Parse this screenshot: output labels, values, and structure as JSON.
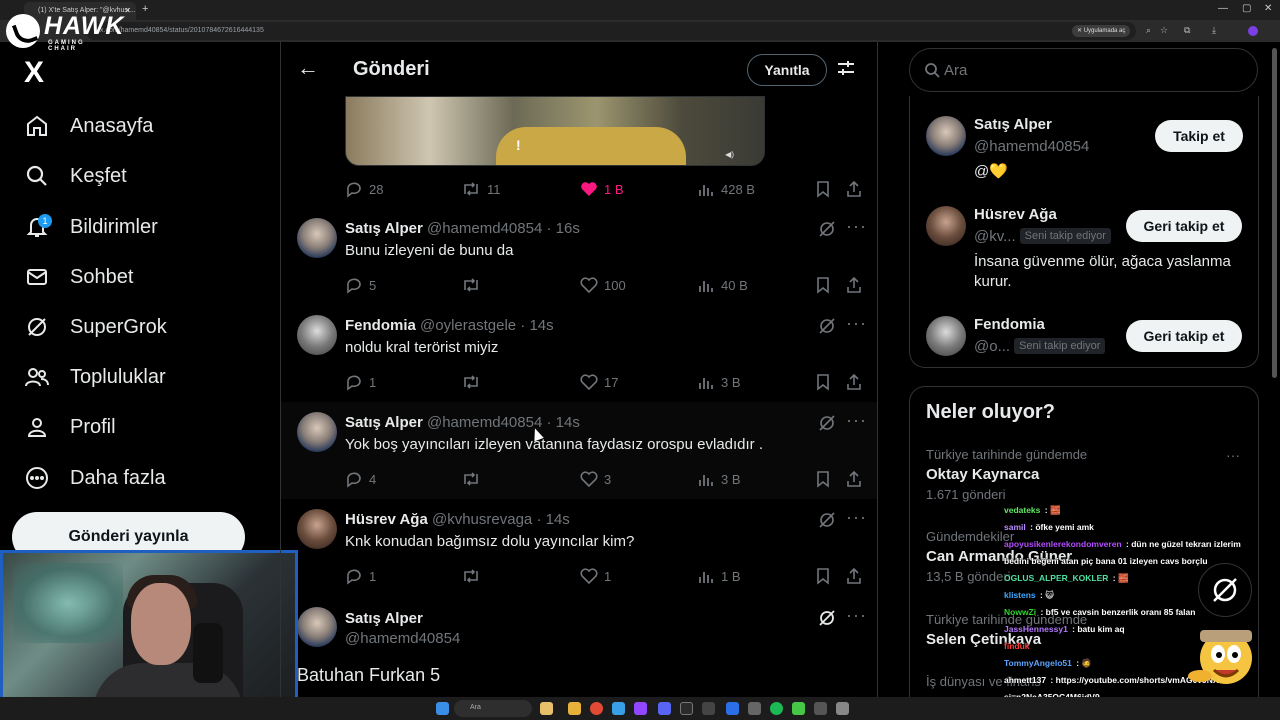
{
  "browser": {
    "tab_title": "(1) X'te Satış Alper: \"@kvhusr...",
    "url": "x.com/hamemd40854/status/2010784672616444135",
    "app_button": "Uygulamada aç"
  },
  "overlay": {
    "brand": "HAWK",
    "brand_sub": "GAMING CHAIR"
  },
  "nav": {
    "logo": "X",
    "items": [
      {
        "label": "Anasayfa",
        "icon": "home-icon"
      },
      {
        "label": "Keşfet",
        "icon": "search-icon"
      },
      {
        "label": "Bildirimler",
        "icon": "bell-icon",
        "badge": "1"
      },
      {
        "label": "Sohbet",
        "icon": "mail-icon"
      },
      {
        "label": "SuperGrok",
        "icon": "grok-icon"
      },
      {
        "label": "Topluluklar",
        "icon": "people-icon"
      },
      {
        "label": "Profil",
        "icon": "person-icon"
      },
      {
        "label": "Daha fazla",
        "icon": "more-circle-icon"
      }
    ],
    "post_button": "Gönderi yayınla"
  },
  "header": {
    "title": "Gönderi",
    "reply_button": "Yanıtla"
  },
  "main_post_stats": {
    "replies": "28",
    "reposts": "11",
    "likes": "1 B",
    "views": "428 B",
    "liked": true,
    "like_color": "#f91880"
  },
  "replies": [
    {
      "name": "Satış Alper",
      "handle": "@hamemd40854",
      "time": "· 16s",
      "text": "Bunu izleyeni de bunu da",
      "replies": "5",
      "reposts": "",
      "likes": "100",
      "views": "40 B"
    },
    {
      "name": "Fendomia",
      "handle": "@oylerastgele",
      "time": "· 14s",
      "text": "noldu kral terörist miyiz",
      "replies": "1",
      "reposts": "",
      "likes": "17",
      "views": "3 B"
    },
    {
      "name": "Satış Alper",
      "handle": "@hamemd40854",
      "time": "· 14s",
      "text": "Yok boş yayıncıları izleyen vatanına faydasız orospu evladıdır .",
      "replies": "4",
      "reposts": "",
      "likes": "3",
      "views": "3 B"
    },
    {
      "name": "Hüsrev Ağa",
      "handle": "@kvhusrevaga",
      "time": "· 14s",
      "text": "Knk konudan bağımsız dolu yayıncılar kim?",
      "replies": "1",
      "reposts": "",
      "likes": "1",
      "views": "1 B"
    }
  ],
  "focused_post": {
    "name": "Satış Alper",
    "handle": "@hamemd40854",
    "text": "Batuhan Furkan 5"
  },
  "search": {
    "placeholder": "Ara"
  },
  "who_to_follow": [
    {
      "name": "Satış Alper",
      "handle": "@hamemd40854",
      "follows_you": "",
      "bio": "@💛",
      "button": "Takip et"
    },
    {
      "name": "Hüsrev Ağa",
      "handle": "@kv...",
      "follows_you": "Seni takip ediyor",
      "bio": "İnsana güvenme ölür, ağaca yaslanma kurur.",
      "button": "Geri takip et"
    },
    {
      "name": "Fendomia",
      "handle": "@o...",
      "follows_you": "Seni takip ediyor",
      "bio": "",
      "button": "Geri takip et"
    }
  ],
  "trends": {
    "title": "Neler oluyor?",
    "items": [
      {
        "category": "Türkiye tarihinde gündemde",
        "name": "Oktay Kaynarca",
        "count": "1.671 gönderi"
      },
      {
        "category": "Gündemdekiler",
        "name": "Can Armando Güner",
        "count": "13,5 B gönderi"
      },
      {
        "category": "Türkiye tarihinde gündemde",
        "name": "Selen Çetinkaya",
        "count": ""
      },
      {
        "category": "İş dünyası ve finans",
        "name": "",
        "count": ""
      }
    ]
  },
  "chat": [
    {
      "user": "vedateks",
      "color": "#62e862",
      "msg": "🧱"
    },
    {
      "user": "samil",
      "color": "#b78bff",
      "msg": "öfke yemi amk"
    },
    {
      "user": "apoyusikenlerekondomveren",
      "color": "#b34dff",
      "msg": "dün ne güzel tekrarı izlerim"
    },
    {
      "user": "",
      "color": "#ffffff",
      "msg": "bedini beğeni atan piç bana 01 izleyen cavs borçlu"
    },
    {
      "user": "OGLUS_ALPER_KOKLER",
      "color": "#4fe0a0",
      "msg": "🧱"
    },
    {
      "user": "klistens",
      "color": "#3fa8ff",
      "msg": "😺"
    },
    {
      "user": "NowwZi",
      "color": "#2fd32f",
      "msg": "bf5 ve cavsin benzerlik oranı 85 falan"
    },
    {
      "user": "JassHennessy1",
      "color": "#b378ff",
      "msg": "batu kim aq"
    },
    {
      "user": "",
      "color": "#ff3b3b",
      "msg": "finduk"
    },
    {
      "user": "TommyAngelo51",
      "color": "#5da3ff",
      "msg": "🧔"
    },
    {
      "user": "ahmett137",
      "color": "#ffffff",
      "msg": "https://youtube.com/shorts/vmAG0vJNXko?"
    },
    {
      "user": "",
      "color": "#ffffff",
      "msg": "si=n2NeA35OC4M6jdV9"
    }
  ],
  "taskbar": {
    "search_placeholder": "Ara"
  }
}
